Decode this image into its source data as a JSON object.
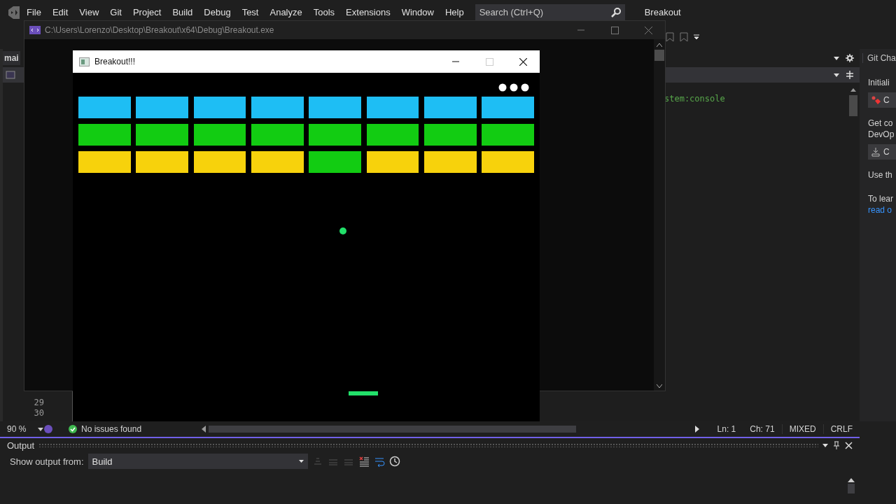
{
  "ide": {
    "menu": [
      "File",
      "Edit",
      "View",
      "Git",
      "Project",
      "Build",
      "Debug",
      "Test",
      "Analyze",
      "Tools",
      "Extensions",
      "Window",
      "Help"
    ],
    "search": {
      "placeholder": "Search (Ctrl+Q)"
    },
    "solution_title": "Breakout",
    "file_tab": "mai",
    "code_text": "stem:console",
    "line_numbers": [
      "29",
      "30"
    ],
    "git_panel": {
      "title": "Git Cha",
      "texts": [
        "Initiali",
        "Get co",
        "DevOp",
        "Use th",
        "To lear"
      ],
      "buttons": [
        {
          "kind": "repo",
          "label": "C"
        },
        {
          "kind": "clone",
          "label": "C"
        }
      ],
      "link": "read o"
    },
    "status": {
      "zoom": "90 %",
      "issues": "No issues found",
      "line": "Ln: 1",
      "column": "Ch: 71",
      "whitespace": "MIXED",
      "line_endings": "CRLF"
    },
    "output": {
      "title": "Output",
      "label": "Show output from:",
      "source": "Build"
    }
  },
  "console": {
    "title": "C:\\Users\\Lorenzo\\Desktop\\Breakout\\x64\\Debug\\Breakout.exe"
  },
  "game": {
    "title": "Breakout!!!",
    "window_buttons": [
      {
        "kind": "minimize",
        "disabled": false
      },
      {
        "kind": "maximize",
        "disabled": true
      },
      {
        "kind": "close",
        "disabled": false
      }
    ],
    "lives": [
      {
        "kind": "life"
      },
      {
        "kind": "life"
      },
      {
        "kind": "life"
      }
    ],
    "bricks": [
      {
        "color": "#1ebef4"
      },
      {
        "color": "#1ebef4"
      },
      {
        "color": "#1ebef4"
      },
      {
        "color": "#1ebef4"
      },
      {
        "color": "#1ebef4"
      },
      {
        "color": "#1ebef4"
      },
      {
        "color": "#1ebef4"
      },
      {
        "color": "#1ebef4"
      },
      {
        "color": "#12cc12"
      },
      {
        "color": "#12cc12"
      },
      {
        "color": "#12cc12"
      },
      {
        "color": "#12cc12"
      },
      {
        "color": "#12cc12"
      },
      {
        "color": "#12cc12"
      },
      {
        "color": "#12cc12"
      },
      {
        "color": "#12cc12"
      },
      {
        "color": "#f7d20c"
      },
      {
        "color": "#f7d20c"
      },
      {
        "color": "#f7d20c"
      },
      {
        "color": "#f7d20c"
      },
      {
        "color": "#12cc12"
      },
      {
        "color": "#f7d20c"
      },
      {
        "color": "#f7d20c"
      },
      {
        "color": "#f7d20c"
      }
    ]
  }
}
